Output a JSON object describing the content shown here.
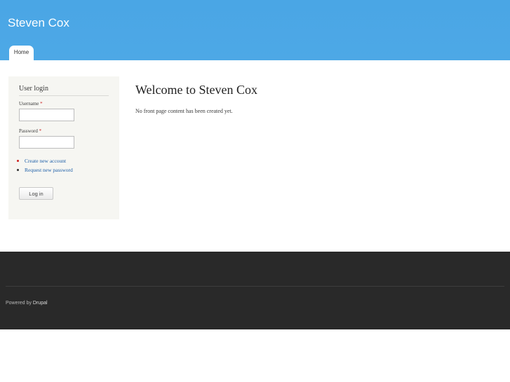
{
  "header": {
    "site_name": "Steven Cox",
    "tabs": [
      {
        "label": "Home"
      }
    ]
  },
  "sidebar": {
    "block_title": "User login",
    "username_label": "Username",
    "password_label": "Password",
    "required_marker": "*",
    "username_value": "",
    "password_value": "",
    "links": [
      {
        "label": "Create new account"
      },
      {
        "label": "Request new password"
      }
    ],
    "login_button": "Log in"
  },
  "main": {
    "title": "Welcome to Steven Cox",
    "text": "No front page content has been created yet."
  },
  "footer": {
    "powered_by": "Powered by",
    "drupal_link": "Drupal"
  },
  "colors": {
    "header_bg": "#4aa6e5",
    "footer_bg": "#292929",
    "sidebar_bg": "#f6f6f2",
    "link": "#1e5fa8",
    "required": "#cc2222"
  }
}
